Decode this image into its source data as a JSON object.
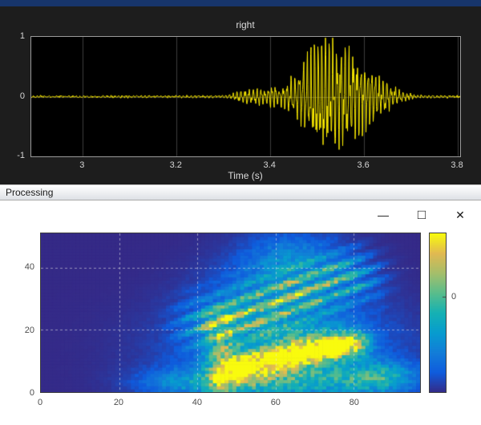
{
  "window": {
    "top_strip_color": "#17356b",
    "processing_title": "Processing",
    "controls": [
      {
        "name": "minimize",
        "glyph": "—"
      },
      {
        "name": "maximize",
        "glyph": "□"
      },
      {
        "name": "close",
        "glyph": "✕"
      }
    ]
  },
  "chart_data": [
    {
      "id": "waveform",
      "type": "line",
      "title": "right",
      "xlabel": "Time (s)",
      "ylabel": "",
      "xlim": [
        2.89,
        3.805
      ],
      "ylim": [
        -1,
        1
      ],
      "xticks": [
        "3",
        "3.2",
        "3.4",
        "3.6",
        "3.8"
      ],
      "xtick_values": [
        3,
        3.2,
        3.4,
        3.6,
        3.8
      ],
      "yticks": [
        "1",
        "0",
        "-1"
      ],
      "ytick_values": [
        1,
        0,
        -1
      ],
      "grid": true,
      "legend": "none",
      "line_color": "#ffef00",
      "plot_bg": "#000000",
      "figure_bg": "#1d1d1d",
      "grid_color": "#3c3c3c",
      "carrier_hz": 122,
      "envelope": [
        [
          2.89,
          0.012
        ],
        [
          3.05,
          0.012
        ],
        [
          3.2,
          0.014
        ],
        [
          3.3,
          0.018
        ],
        [
          3.32,
          0.05
        ],
        [
          3.345,
          0.13
        ],
        [
          3.36,
          0.09
        ],
        [
          3.375,
          0.15
        ],
        [
          3.39,
          0.11
        ],
        [
          3.405,
          0.17
        ],
        [
          3.42,
          0.13
        ],
        [
          3.435,
          0.22
        ],
        [
          3.45,
          0.3
        ],
        [
          3.465,
          0.45
        ],
        [
          3.48,
          0.62
        ],
        [
          3.495,
          0.85
        ],
        [
          3.51,
          0.93
        ],
        [
          3.525,
          0.88
        ],
        [
          3.54,
          0.78
        ],
        [
          3.555,
          0.82
        ],
        [
          3.57,
          0.72
        ],
        [
          3.585,
          0.6
        ],
        [
          3.6,
          0.52
        ],
        [
          3.615,
          0.42
        ],
        [
          3.63,
          0.33
        ],
        [
          3.645,
          0.24
        ],
        [
          3.66,
          0.16
        ],
        [
          3.675,
          0.1
        ],
        [
          3.69,
          0.06
        ],
        [
          3.71,
          0.035
        ],
        [
          3.74,
          0.02
        ],
        [
          3.805,
          0.012
        ]
      ]
    },
    {
      "id": "spectrogram",
      "type": "heatmap",
      "xlim": [
        0,
        97
      ],
      "ylim": [
        0,
        51
      ],
      "xticks": [
        "0",
        "20",
        "40",
        "60",
        "80"
      ],
      "xtick_values": [
        0,
        20,
        40,
        60,
        80
      ],
      "yticks": [
        "40",
        "20",
        "0"
      ],
      "ytick_values": [
        40,
        20,
        0
      ],
      "grid": "dashed",
      "colormap": [
        "#352a87",
        "#0f5cdd",
        "#127dd8",
        "#079ccf",
        "#15b1b4",
        "#59bd8c",
        "#a5be6b",
        "#e1b952",
        "#f9fb0e"
      ],
      "colorbar_tick": {
        "label": "0",
        "frac": 0.6
      },
      "blobs": [
        [
          63,
          13,
          20,
          11,
          0.22
        ],
        [
          60,
          30,
          12,
          10,
          0.18
        ],
        [
          64,
          43,
          8,
          6,
          0.22
        ],
        [
          66,
          4,
          17,
          4,
          0.38
        ],
        [
          50,
          5,
          6,
          4,
          0.25
        ],
        [
          36,
          3,
          8,
          3,
          0.22
        ],
        [
          87,
          5,
          6,
          3.5,
          0.3
        ],
        [
          68,
          18,
          10,
          3,
          0.18
        ]
      ],
      "ridges": [
        [
          44,
          22,
          78,
          37,
          5.5,
          0.45,
          1
        ],
        [
          50,
          8.5,
          80,
          15.5,
          2.8,
          0.75,
          0
        ],
        [
          60,
          11,
          76,
          15,
          1.8,
          0.4,
          0
        ],
        [
          46,
          2,
          46,
          24,
          2.5,
          0.3,
          0
        ]
      ]
    }
  ]
}
